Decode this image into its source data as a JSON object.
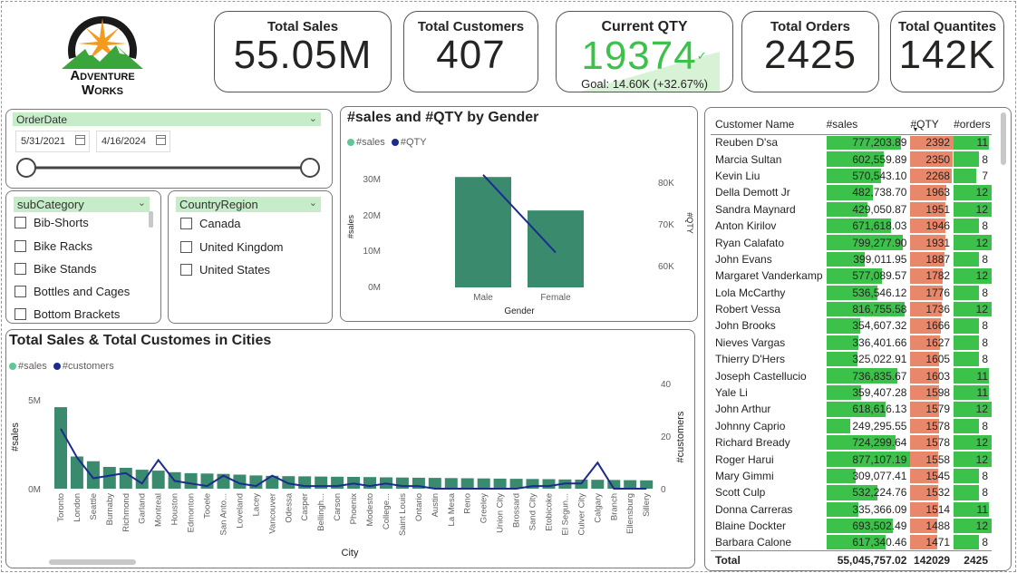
{
  "logo": {
    "line1": "Adventure",
    "line2": "Works"
  },
  "kpis": [
    {
      "title": "Total Sales",
      "value": "55.05M"
    },
    {
      "title": "Total Customers",
      "value": "407"
    },
    {
      "title": "Current QTY",
      "value": "19374",
      "check": "✓",
      "goal": "Goal: 14.60K (+32.67%)"
    },
    {
      "title": "Total Orders",
      "value": "2425"
    },
    {
      "title": "Total Quantites",
      "value": "142K"
    }
  ],
  "date_slicer": {
    "title": "OrderDate",
    "start": "5/31/2021",
    "end": "4/16/2024"
  },
  "subcategory_slicer": {
    "title": "subCategory",
    "items": [
      "Bib-Shorts",
      "Bike Racks",
      "Bike Stands",
      "Bottles and Cages",
      "Bottom Brackets"
    ]
  },
  "country_slicer": {
    "title": "CountryRegion",
    "items": [
      "Canada",
      "United Kingdom",
      "United States"
    ]
  },
  "colors": {
    "accent_green": "#3cc14b",
    "bar_teal": "#3a8a6e",
    "line_navy": "#1c2b8f",
    "qty_orange": "#e8876a",
    "legend_sales": "#5fc797",
    "slicer_header": "#c6ecc9"
  },
  "gender_chart": {
    "title": "#sales and #QTY by Gender",
    "legend": [
      "#sales",
      "#QTY"
    ],
    "xlabel": "Gender",
    "ylabel_left": "#sales",
    "ylabel_right": "#QTY",
    "left_ticks": [
      "30M",
      "20M",
      "10M",
      "0M"
    ],
    "right_ticks": [
      "80K",
      "70K",
      "60K"
    ],
    "categories": [
      "Male",
      "Female"
    ]
  },
  "city_chart": {
    "title": "Total Sales & Total Customes in Cities",
    "legend": [
      "#sales",
      "#customers"
    ],
    "xlabel": "City",
    "ylabel_left": "#sales",
    "ylabel_right": "#customers",
    "left_ticks": [
      "5M",
      "0M"
    ],
    "right_ticks": [
      "40",
      "20",
      "0"
    ]
  },
  "chart_data": [
    {
      "type": "bar",
      "title": "#sales and #QTY by Gender",
      "xlabel": "Gender",
      "ylabel": "#sales",
      "y2label": "#QTY",
      "categories": [
        "Male",
        "Female"
      ],
      "series": [
        {
          "name": "#sales",
          "type": "bar",
          "axis": "left",
          "values": [
            32000000,
            22300000
          ]
        },
        {
          "name": "#QTY",
          "type": "line",
          "axis": "right",
          "values": [
            83000,
            63000
          ]
        }
      ],
      "ylim": [
        0,
        36000000
      ],
      "y2lim": [
        54000,
        86000
      ]
    },
    {
      "type": "bar",
      "title": "Total Sales & Total Customes in Cities",
      "xlabel": "City",
      "ylabel": "#sales",
      "y2label": "#customers",
      "categories": [
        "Toronto",
        "London",
        "Seattle",
        "Burnaby",
        "Richmond",
        "Garland",
        "Montreal",
        "Houston",
        "Edmonton",
        "Tooele",
        "San Anto...",
        "Loveland",
        "Lacey",
        "Vancouver",
        "Odessa",
        "Casper",
        "Bellingh...",
        "Carson",
        "Phoenix",
        "Modesto",
        "College...",
        "Saint Louis",
        "Ontario",
        "Austin",
        "La Mesa",
        "Reno",
        "Greeley",
        "Union City",
        "Brossard",
        "Sand City",
        "Etobicoke",
        "El Segun...",
        "Culver City",
        "Calgary",
        "Branch",
        "Ellensburg",
        "Sillery"
      ],
      "series": [
        {
          "name": "#sales",
          "type": "bar",
          "axis": "left",
          "values": [
            4300000,
            1700000,
            1450000,
            1150000,
            1100000,
            1000000,
            950000,
            870000,
            820000,
            800000,
            780000,
            740000,
            700000,
            680000,
            660000,
            650000,
            640000,
            630000,
            620000,
            610000,
            600000,
            590000,
            580000,
            570000,
            560000,
            550000,
            540000,
            530000,
            520000,
            510000,
            500000,
            490000,
            480000,
            470000,
            460000,
            450000,
            440000
          ]
        },
        {
          "name": "#customers",
          "type": "line",
          "axis": "right",
          "values": [
            23,
            12,
            4,
            5,
            6,
            2,
            11,
            3,
            2,
            1,
            5,
            2,
            1,
            5,
            2,
            1,
            1,
            1,
            2,
            1,
            2,
            1,
            1,
            0,
            0,
            0,
            0,
            0,
            0,
            1,
            1,
            2,
            2,
            10,
            0,
            0,
            0
          ]
        }
      ],
      "ylim": [
        0,
        5500000
      ],
      "y2lim": [
        0,
        40
      ]
    }
  ],
  "table": {
    "headers": [
      "Customer Name",
      "#sales",
      "#QTY",
      "#orders"
    ],
    "rows": [
      [
        "Reuben D'sa",
        "777,203.89",
        "2392",
        "11"
      ],
      [
        "Marcia Sultan",
        "602,559.89",
        "2350",
        "8"
      ],
      [
        "Kevin Liu",
        "570,543.10",
        "2268",
        "7"
      ],
      [
        "Della Demott Jr",
        "482,738.70",
        "1963",
        "12"
      ],
      [
        "Sandra Maynard",
        "429,050.87",
        "1951",
        "12"
      ],
      [
        "Anton Kirilov",
        "671,618.03",
        "1946",
        "8"
      ],
      [
        "Ryan Calafato",
        "799,277.90",
        "1931",
        "12"
      ],
      [
        "John Evans",
        "399,011.95",
        "1887",
        "8"
      ],
      [
        "Margaret Vanderkamp",
        "577,089.57",
        "1782",
        "12"
      ],
      [
        "Lola McCarthy",
        "536,546.12",
        "1776",
        "8"
      ],
      [
        "Robert Vessa",
        "816,755.58",
        "1736",
        "12"
      ],
      [
        "John Brooks",
        "354,607.32",
        "1666",
        "8"
      ],
      [
        "Nieves Vargas",
        "336,401.66",
        "1627",
        "8"
      ],
      [
        "Thierry D'Hers",
        "325,022.91",
        "1605",
        "8"
      ],
      [
        "Joseph Castellucio",
        "736,835.67",
        "1603",
        "11"
      ],
      [
        "Yale Li",
        "359,407.28",
        "1598",
        "11"
      ],
      [
        "John Arthur",
        "618,616.13",
        "1579",
        "12"
      ],
      [
        "Johnny Caprio",
        "249,295.55",
        "1578",
        "8"
      ],
      [
        "Richard Bready",
        "724,299.64",
        "1578",
        "12"
      ],
      [
        "Roger Harui",
        "877,107.19",
        "1558",
        "12"
      ],
      [
        "Mary Gimmi",
        "309,077.41",
        "1545",
        "8"
      ],
      [
        "Scott Culp",
        "532,224.76",
        "1532",
        "8"
      ],
      [
        "Donna Carreras",
        "335,366.09",
        "1514",
        "11"
      ],
      [
        "Blaine Dockter",
        "693,502.49",
        "1488",
        "12"
      ],
      [
        "Barbara Calone",
        "617,340.46",
        "1471",
        "8"
      ]
    ],
    "total": [
      "Total",
      "55,045,757.02",
      "142029",
      "2425"
    ]
  }
}
